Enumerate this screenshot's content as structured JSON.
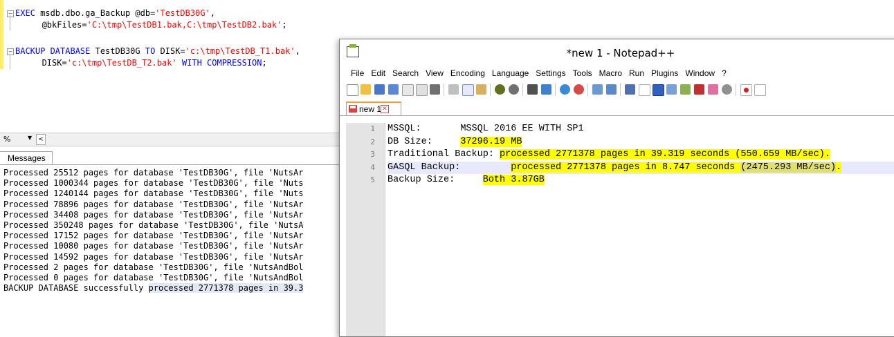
{
  "ssms": {
    "editor": {
      "line1": {
        "exec": "EXEC ",
        "proc": "msdb.dbo.ga_Backup",
        "param": " @db=",
        "value": "'TestDB30G'",
        "comma": ","
      },
      "line2": {
        "param": "    @bkFiles=",
        "value": "'C:\\tmp\\TestDB1.bak,C:\\tmp\\TestDB2.bak'",
        "semi": ";"
      },
      "line3": {
        "kw1": "BACKUP DATABASE",
        "db": " TestDB30G ",
        "kw2": "TO",
        "disk": " DISK=",
        "value": "'c:\\tmp\\TestDB_T1.bak'",
        "comma": ","
      },
      "line4": {
        "disk": "    DISK=",
        "value": "'c:\\tmp\\TestDB_T2.bak'",
        "with": " WITH COMPRESSION",
        "semi": ";"
      }
    },
    "zoom": "%",
    "messages_tab": "Messages",
    "messages": [
      "Processed 25512 pages for database 'TestDB30G', file 'NutsAr",
      "Processed 1000344 pages for database 'TestDB30G', file 'Nuts",
      "Processed 1240144 pages for database 'TestDB30G', file 'Nuts",
      "Processed 78896 pages for database 'TestDB30G', file 'NutsAr",
      "Processed 34408 pages for database 'TestDB30G', file 'NutsAr",
      "Processed 350248 pages for database 'TestDB30G', file 'NutsA",
      "Processed 17152 pages for database 'TestDB30G', file 'NutsAr",
      "Processed 10080 pages for database 'TestDB30G', file 'NutsAr",
      "Processed 14592 pages for database 'TestDB30G', file 'NutsAr",
      "Processed 2 pages for database 'TestDB30G', file 'NutsAndBol",
      "Processed 0 pages for database 'TestDB30G', file 'NutsAndBol"
    ],
    "last_message": {
      "prefix": "BACKUP DATABASE successfully ",
      "selected": "processed 2771378 pages in 39.3"
    }
  },
  "npp": {
    "title": "*new 1 - Notepad++",
    "menu": [
      "File",
      "Edit",
      "Search",
      "View",
      "Encoding",
      "Language",
      "Settings",
      "Tools",
      "Macro",
      "Run",
      "Plugins",
      "Window",
      "?"
    ],
    "tab_label": "new 1",
    "tab_close": "✕",
    "line_numbers": [
      "1",
      "2",
      "3",
      "4",
      "5"
    ],
    "lines": {
      "l1": "MSSQL:       MSSQL 2016 EE WITH SP1",
      "l2_label": "DB Size:     ",
      "l2_value": "37296.19 MB",
      "l3_label": "Traditional Backup: ",
      "l3_value": "processed 2771378 pages in 39.319 seconds (550.659 MB/sec).",
      "l4_label": "GASQL Backup:         ",
      "l4_value_a": "processed 2771378 pages in 8.747 seconds ",
      "l4_value_b": "(2475.293 MB/sec)",
      "l4_value_c": ".",
      "l5_label": "Backup Size:     ",
      "l5_value": "Both 3.87GB"
    }
  },
  "colors": {
    "highlight": "#ffff00",
    "keyword": "#0000ff",
    "string": "#ff0000"
  }
}
